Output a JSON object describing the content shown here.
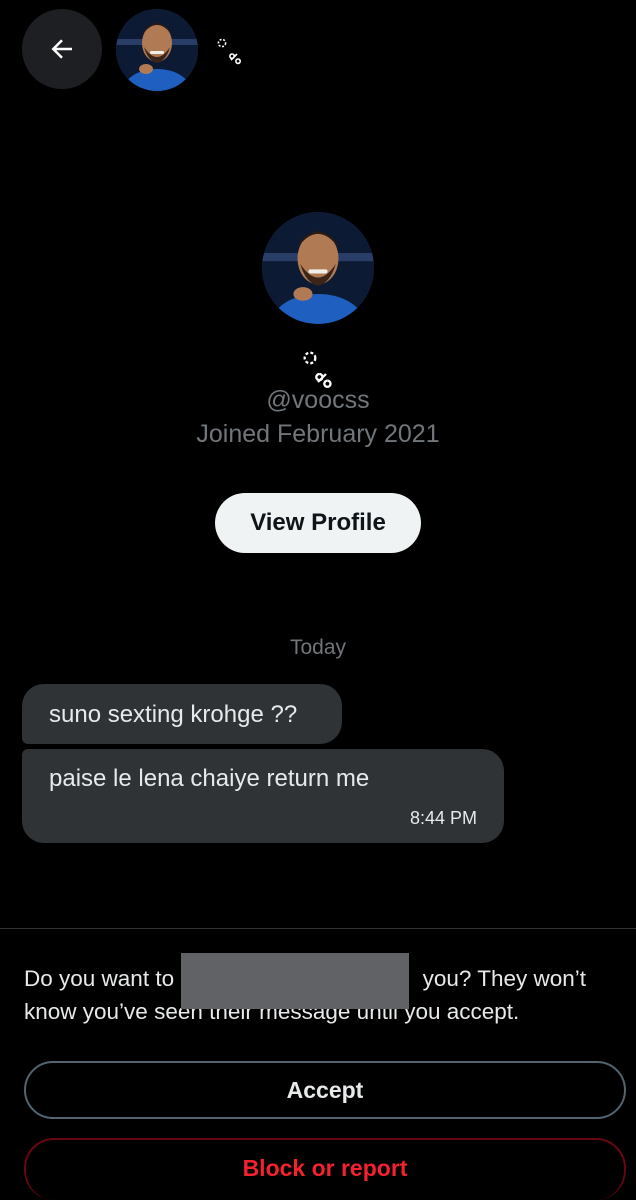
{
  "header": {
    "back_icon": "arrow-left-icon",
    "display_name_icon": "decorative-symbol-name"
  },
  "profile": {
    "handle": "@voocss",
    "joined": "Joined February 2021",
    "view_profile_label": "View Profile"
  },
  "conversation": {
    "day_label": "Today",
    "messages": [
      {
        "text": "suno sexting krohge ??"
      },
      {
        "text": "paise le lena chaiye return me",
        "time": "8:44 PM"
      }
    ]
  },
  "request": {
    "text_before": "Do you want to",
    "text_after": "you? They won’t know you’ve seen their message until you accept.",
    "accept_label": "Accept",
    "block_label": "Block or report"
  },
  "colors": {
    "background": "#000000",
    "bubble": "#2f3336",
    "muted_text": "#71767b",
    "danger": "#f4212e",
    "redaction": "#606265"
  }
}
